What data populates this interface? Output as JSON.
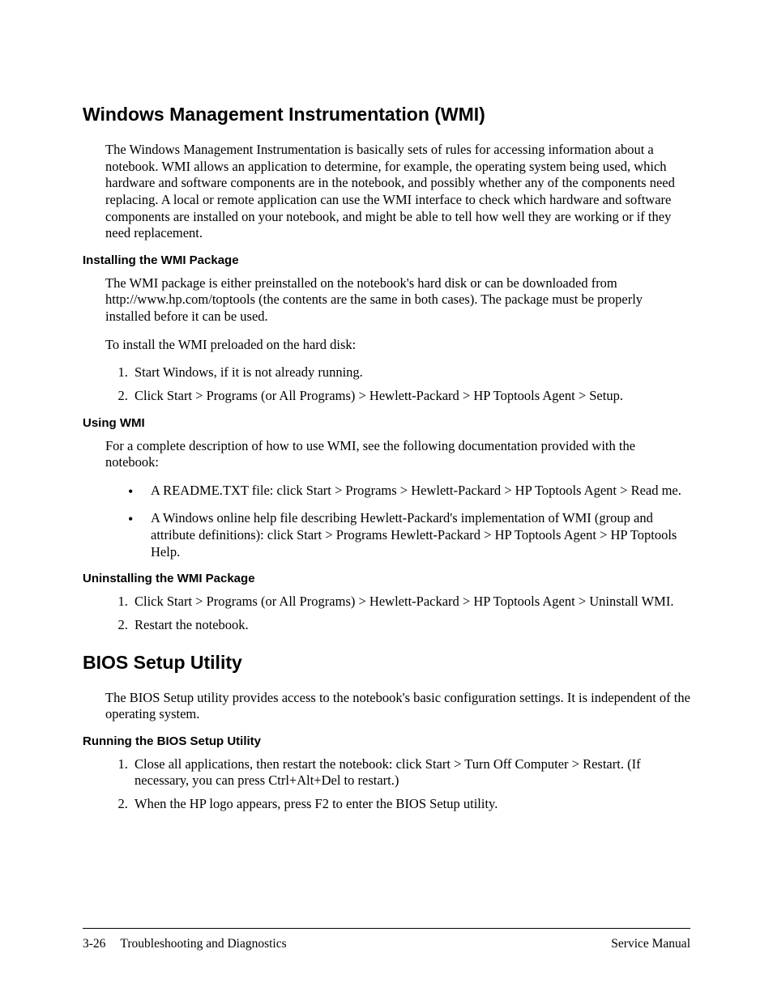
{
  "section1": {
    "title": "Windows Management Instrumentation (WMI)",
    "intro": "The Windows Management Instrumentation is basically sets of rules for accessing information about a notebook. WMI allows an application to determine, for example, the operating system being used, which hardware and software components are in the notebook, and possibly whether any of the components need replacing. A local or remote application can use the WMI interface to check which hardware and software components are installed on your notebook, and might be able to tell how well they are working or if they need replacement.",
    "install": {
      "heading": "Installing the WMI Package",
      "p1": "The WMI package is either preinstalled on the notebook's hard disk or can be downloaded from http://www.hp.com/toptools (the contents are the same in both cases). The package must be properly installed before it can be used.",
      "p2": "To install the WMI preloaded on the hard disk:",
      "steps": [
        "Start Windows, if it is not already running.",
        "Click Start > Programs (or All Programs) > Hewlett-Packard > HP Toptools Agent > Setup."
      ]
    },
    "using": {
      "heading": "Using WMI",
      "p1": "For a complete description of how to use WMI, see the following documentation provided with the notebook:",
      "bullets": [
        "A README.TXT file: click Start > Programs > Hewlett-Packard > HP Toptools Agent > Read me.",
        "A Windows online help file describing Hewlett-Packard's implementation of WMI (group and attribute definitions): click Start > Programs Hewlett-Packard > HP Toptools Agent > HP Toptools Help."
      ]
    },
    "uninstall": {
      "heading": "Uninstalling the WMI Package",
      "steps": [
        "Click Start > Programs (or All Programs) > Hewlett-Packard > HP Toptools Agent > Uninstall WMI.",
        "Restart the notebook."
      ]
    }
  },
  "section2": {
    "title": "BIOS Setup Utility",
    "intro": "The BIOS Setup utility provides access to the notebook's basic configuration settings. It is independent of the operating system.",
    "running": {
      "heading": "Running the BIOS Setup Utility",
      "steps": [
        "Close all applications, then restart the notebook: click Start > Turn Off Computer > Restart. (If necessary, you can press Ctrl+Alt+Del to restart.)",
        "When the HP logo appears, press F2 to enter the BIOS Setup utility."
      ]
    }
  },
  "footer": {
    "page": "3-26",
    "section": "Troubleshooting and Diagnostics",
    "doc": "Service Manual"
  }
}
